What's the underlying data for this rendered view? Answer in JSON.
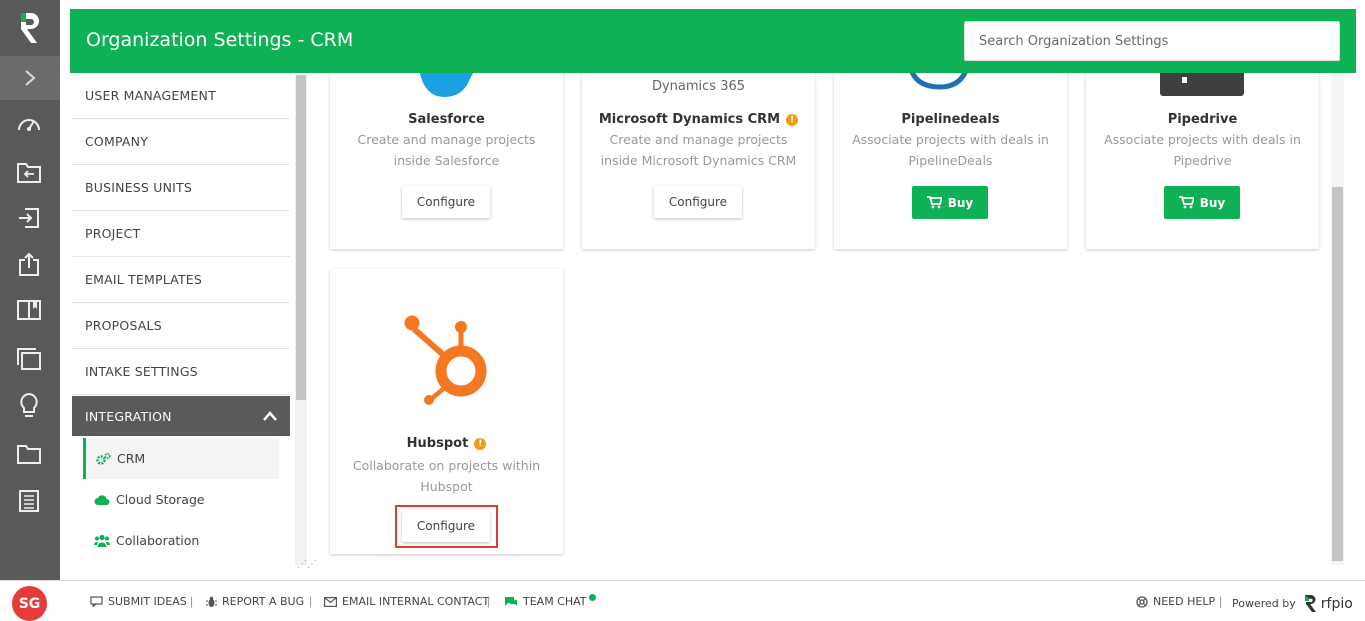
{
  "header": {
    "title": "Organization Settings - CRM",
    "search_placeholder": "Search Organization Settings"
  },
  "nav": {
    "items": [
      {
        "label": "USER MANAGEMENT"
      },
      {
        "label": "COMPANY"
      },
      {
        "label": "BUSINESS UNITS"
      },
      {
        "label": "PROJECT"
      },
      {
        "label": "EMAIL TEMPLATES"
      },
      {
        "label": "PROPOSALS"
      },
      {
        "label": "INTAKE SETTINGS"
      }
    ],
    "active_section": "INTEGRATION",
    "sub_items": [
      {
        "label": "CRM",
        "icon": "cogs-icon"
      },
      {
        "label": "Cloud Storage",
        "icon": "cloud-icon"
      },
      {
        "label": "Collaboration",
        "icon": "users-icon"
      }
    ]
  },
  "cards": [
    {
      "name": "Salesforce",
      "desc": "Create and manage projects inside Salesforce",
      "button": "Configure",
      "warning": false
    },
    {
      "name": "Microsoft Dynamics CRM",
      "logo_text": "Dynamics 365",
      "desc": "Create and manage projects inside Microsoft Dynamics CRM",
      "button": "Configure",
      "warning": true
    },
    {
      "name": "Pipelinedeals",
      "desc": "Associate projects with deals in PipelineDeals",
      "button": "Buy",
      "warning": false
    },
    {
      "name": "Pipedrive",
      "desc": "Associate projects with deals in Pipedrive",
      "button": "Buy",
      "warning": false
    },
    {
      "name": "Hubspot",
      "desc": "Collaborate on projects within Hubspot",
      "button": "Configure",
      "warning": true
    }
  ],
  "footer": {
    "avatar": "SG",
    "links": [
      "SUBMIT IDEAS",
      "REPORT A BUG",
      "EMAIL INTERNAL CONTACT",
      "TEAM CHAT"
    ],
    "need_help": "NEED HELP",
    "powered_by": "Powered by",
    "brand": "rfpio"
  },
  "colors": {
    "brand_green": "#0fb155",
    "rail": "#595959",
    "warning": "#f39c12",
    "hubspot_orange": "#f57722",
    "salesforce_blue": "#1ba1e2",
    "pipelinedeals_blue": "#1f6fb5",
    "highlight_red": "#e53935"
  }
}
